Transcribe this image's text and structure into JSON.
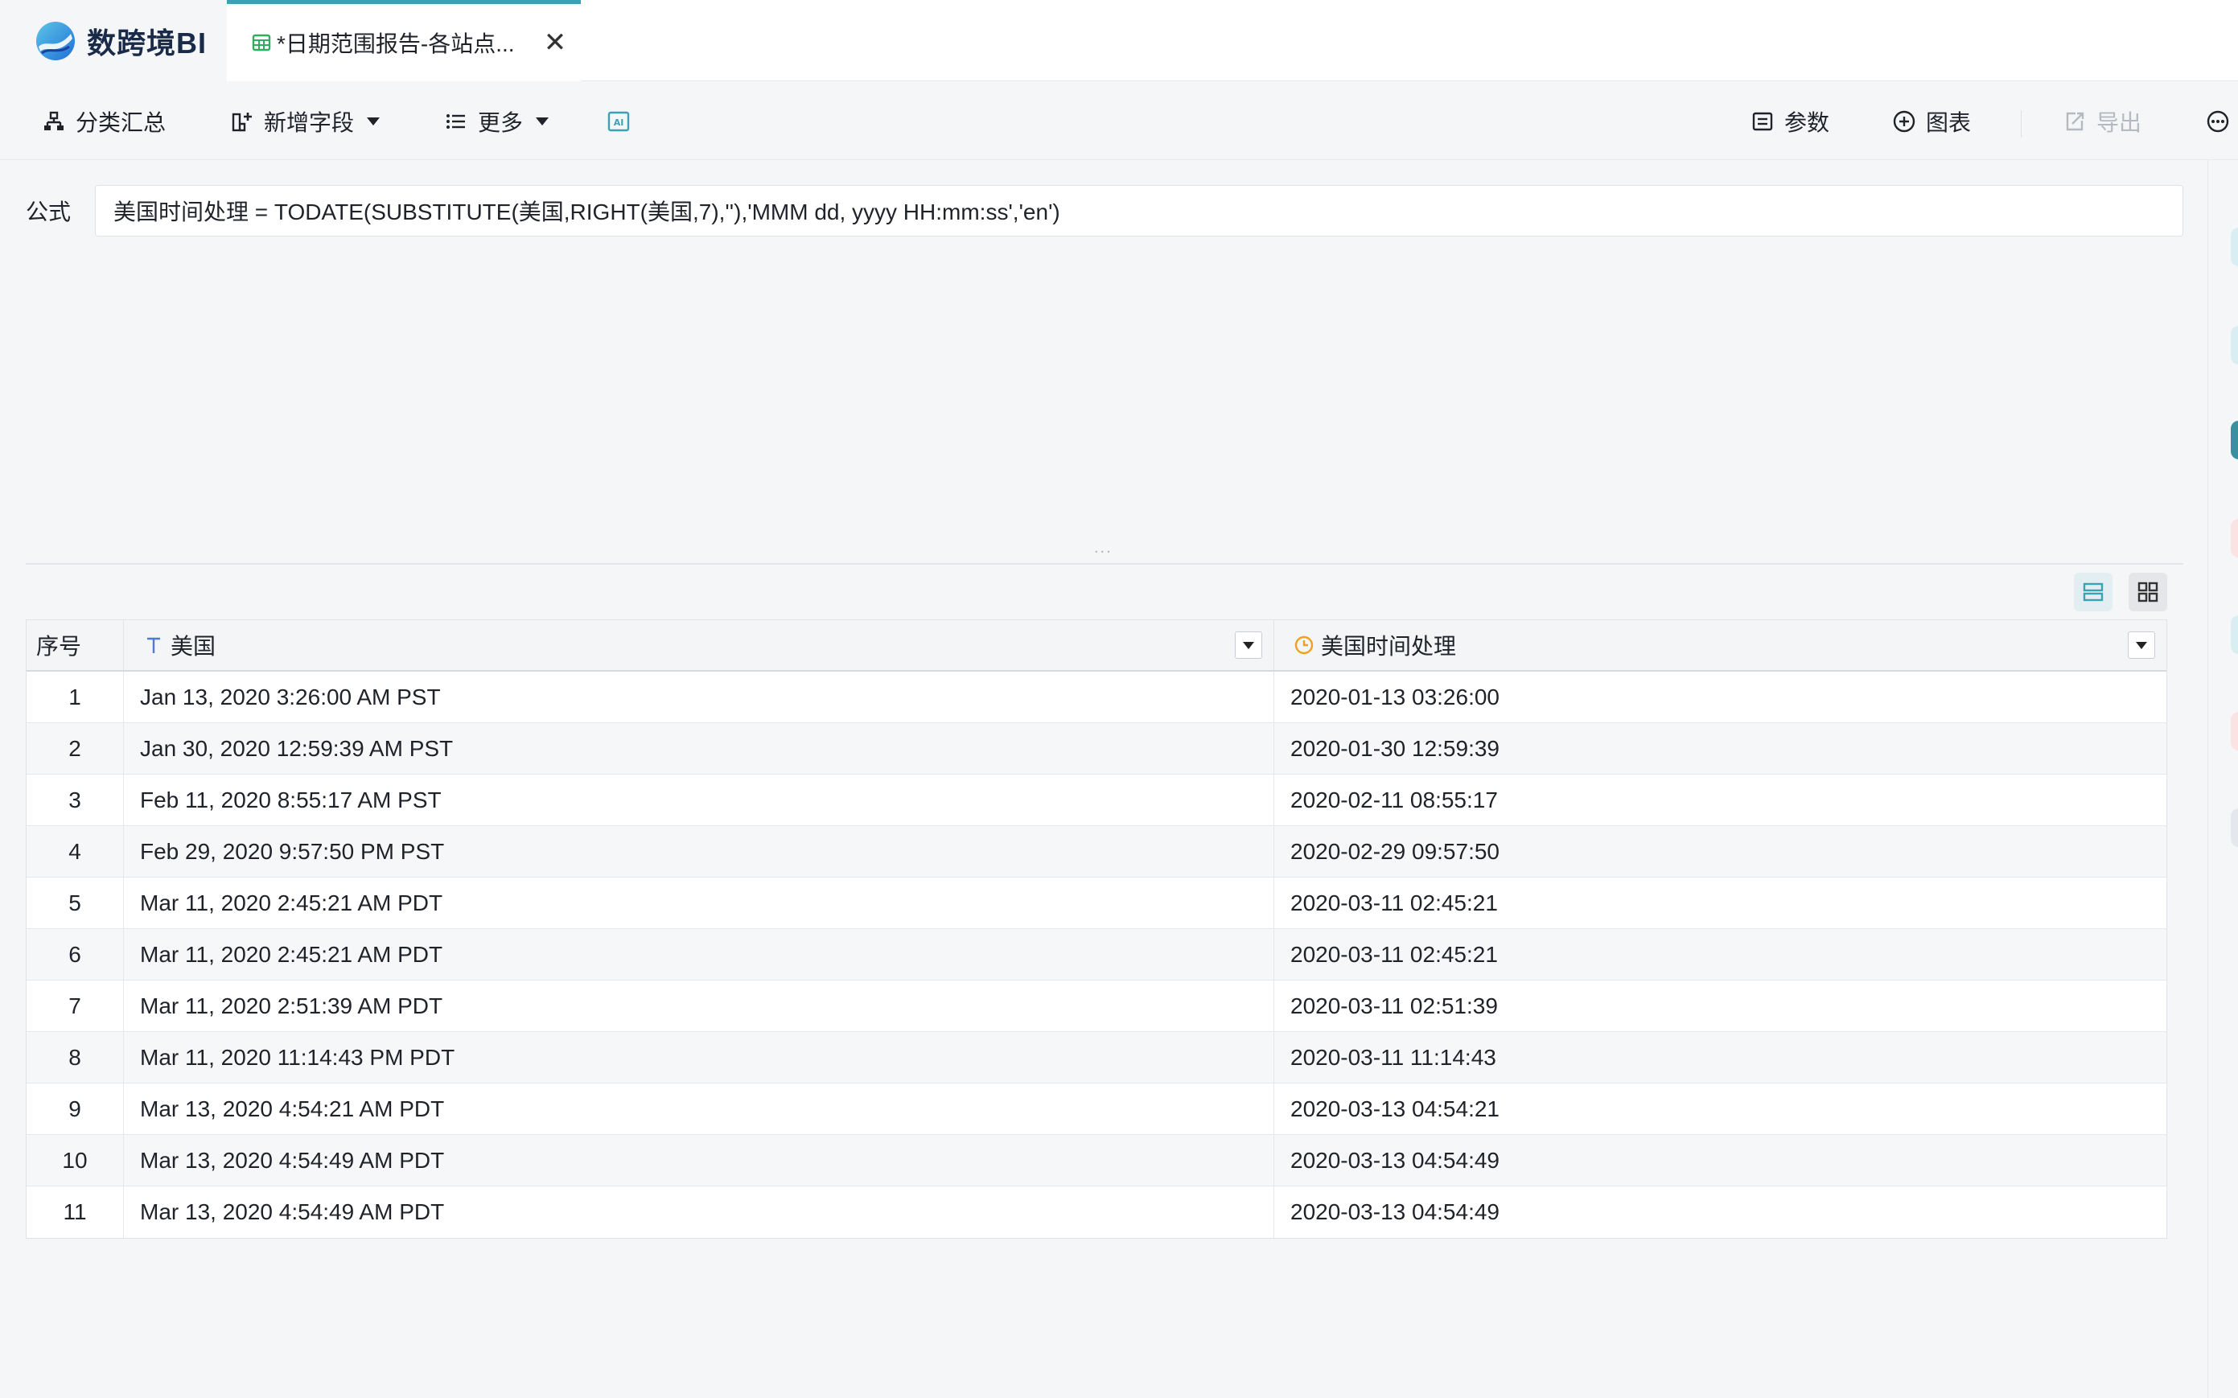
{
  "app": {
    "name": "数跨境BI",
    "colors": {
      "accent": "#3aa2b2",
      "tab_icon": "#2fae5e",
      "date_icon": "#f0a020",
      "text_icon": "#4a7bd6"
    }
  },
  "tab": {
    "title": "*日期范围报告-各站点...",
    "close_label": "✕",
    "icon": "table-icon"
  },
  "toolbar": {
    "left": [
      {
        "label": "分类汇总",
        "icon": "hierarchy-icon"
      },
      {
        "label": "新增字段",
        "icon": "add-column-icon",
        "dropdown": true
      },
      {
        "label": "更多",
        "icon": "list-icon",
        "dropdown": true
      },
      {
        "label": "",
        "icon": "ai-icon"
      }
    ],
    "right": [
      {
        "label": "参数",
        "icon": "parameter-icon"
      },
      {
        "label": "图表",
        "icon": "plus-circle-icon"
      },
      {
        "label": "导出",
        "icon": "export-icon",
        "disabled": true
      },
      {
        "label": "",
        "icon": "more-circle-icon"
      }
    ]
  },
  "formula": {
    "label": "公式",
    "value": "美国时间处理 = TODATE(SUBSTITUTE(美国,RIGHT(美国,7),''),'MMM dd, yyyy HH:mm:ss','en')",
    "splitter_dots": "..."
  },
  "table": {
    "headers": {
      "index": "序号",
      "us": "美国",
      "converted": "美国时间处理"
    },
    "rows": [
      {
        "idx": "1",
        "us": "Jan 13, 2020 3:26:00 AM PST",
        "dt": "2020-01-13 03:26:00"
      },
      {
        "idx": "2",
        "us": "Jan 30, 2020 12:59:39 AM PST",
        "dt": "2020-01-30 12:59:39"
      },
      {
        "idx": "3",
        "us": "Feb 11, 2020 8:55:17 AM PST",
        "dt": "2020-02-11 08:55:17"
      },
      {
        "idx": "4",
        "us": "Feb 29, 2020 9:57:50 PM PST",
        "dt": "2020-02-29 09:57:50"
      },
      {
        "idx": "5",
        "us": "Mar 11, 2020 2:45:21 AM PDT",
        "dt": "2020-03-11 02:45:21"
      },
      {
        "idx": "6",
        "us": "Mar 11, 2020 2:45:21 AM PDT",
        "dt": "2020-03-11 02:45:21"
      },
      {
        "idx": "7",
        "us": "Mar 11, 2020 2:51:39 AM PDT",
        "dt": "2020-03-11 02:51:39"
      },
      {
        "idx": "8",
        "us": "Mar 11, 2020 11:14:43 PM PDT",
        "dt": "2020-03-11 11:14:43"
      },
      {
        "idx": "9",
        "us": "Mar 13, 2020 4:54:21 AM PDT",
        "dt": "2020-03-13 04:54:21"
      },
      {
        "idx": "10",
        "us": "Mar 13, 2020 4:54:49 AM PDT",
        "dt": "2020-03-13 04:54:49"
      },
      {
        "idx": "11",
        "us": "Mar 13, 2020 4:54:49 AM PDT",
        "dt": "2020-03-13 04:54:49"
      }
    ]
  }
}
